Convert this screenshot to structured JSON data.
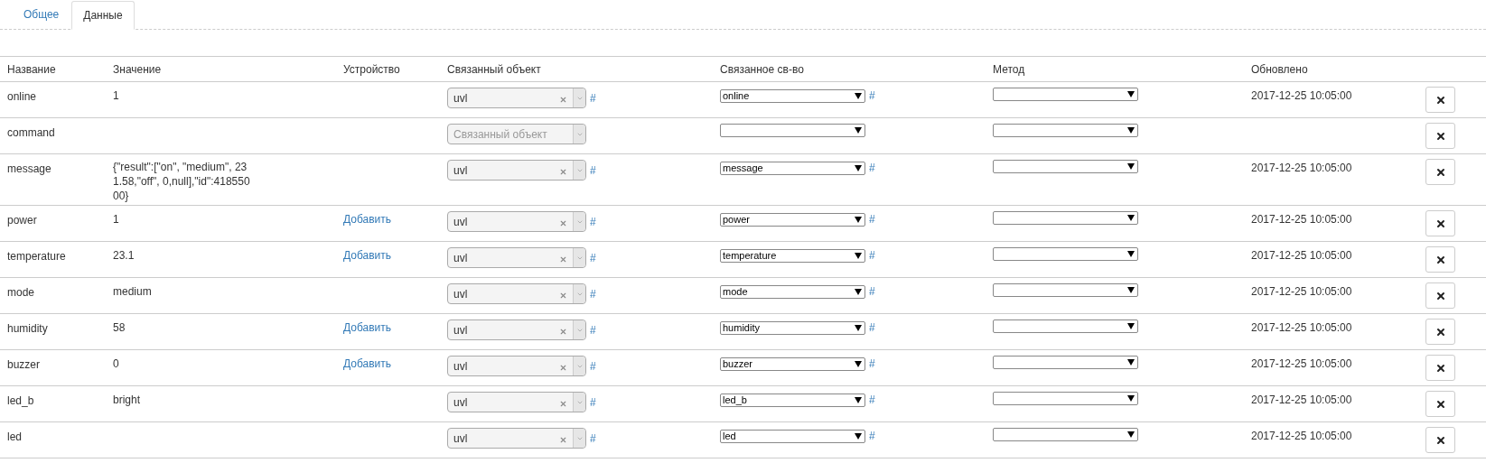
{
  "tabs": [
    {
      "label": "Общее",
      "selected": false
    },
    {
      "label": "Данные",
      "selected": true
    }
  ],
  "table": {
    "columns": [
      "Название",
      "Значение",
      "Устройство",
      "Связанный объект",
      "Связанное св-во",
      "Метод",
      "Обновлено"
    ],
    "rows": [
      {
        "name": "online",
        "value": "1",
        "device_link": null,
        "object": "uvl",
        "object_placeholder": null,
        "property": "online",
        "method": "",
        "updated": "2017-12-25 10:05:00"
      },
      {
        "name": "command",
        "value": "",
        "device_link": null,
        "object": null,
        "object_placeholder": "Связанный объект",
        "property": "",
        "method": "",
        "updated": ""
      },
      {
        "name": "message",
        "value": "{\"result\":[\"on\", \"medium\", 231.58,\"off\", 0,null],\"id\":41855000}",
        "device_link": null,
        "object": "uvl",
        "object_placeholder": null,
        "property": "message",
        "method": "",
        "updated": "2017-12-25 10:05:00"
      },
      {
        "name": "power",
        "value": "1",
        "device_link": "Добавить",
        "object": "uvl",
        "object_placeholder": null,
        "property": "power",
        "method": "",
        "updated": "2017-12-25 10:05:00"
      },
      {
        "name": "temperature",
        "value": "23.1",
        "device_link": "Добавить",
        "object": "uvl",
        "object_placeholder": null,
        "property": "temperature",
        "method": "",
        "updated": "2017-12-25 10:05:00"
      },
      {
        "name": "mode",
        "value": "medium",
        "device_link": null,
        "object": "uvl",
        "object_placeholder": null,
        "property": "mode",
        "method": "",
        "updated": "2017-12-25 10:05:00"
      },
      {
        "name": "humidity",
        "value": "58",
        "device_link": "Добавить",
        "object": "uvl",
        "object_placeholder": null,
        "property": "humidity",
        "method": "",
        "updated": "2017-12-25 10:05:00"
      },
      {
        "name": "buzzer",
        "value": "0",
        "device_link": "Добавить",
        "object": "uvl",
        "object_placeholder": null,
        "property": "buzzer",
        "method": "",
        "updated": "2017-12-25 10:05:00"
      },
      {
        "name": "led_b",
        "value": "bright",
        "device_link": null,
        "object": "uvl",
        "object_placeholder": null,
        "property": "led_b",
        "method": "",
        "updated": "2017-12-25 10:05:00"
      },
      {
        "name": "led",
        "value": "",
        "device_link": null,
        "object": "uvl",
        "object_placeholder": null,
        "property": "led",
        "method": "",
        "updated": "2017-12-25 10:05:00"
      }
    ]
  },
  "hash_label": "#"
}
